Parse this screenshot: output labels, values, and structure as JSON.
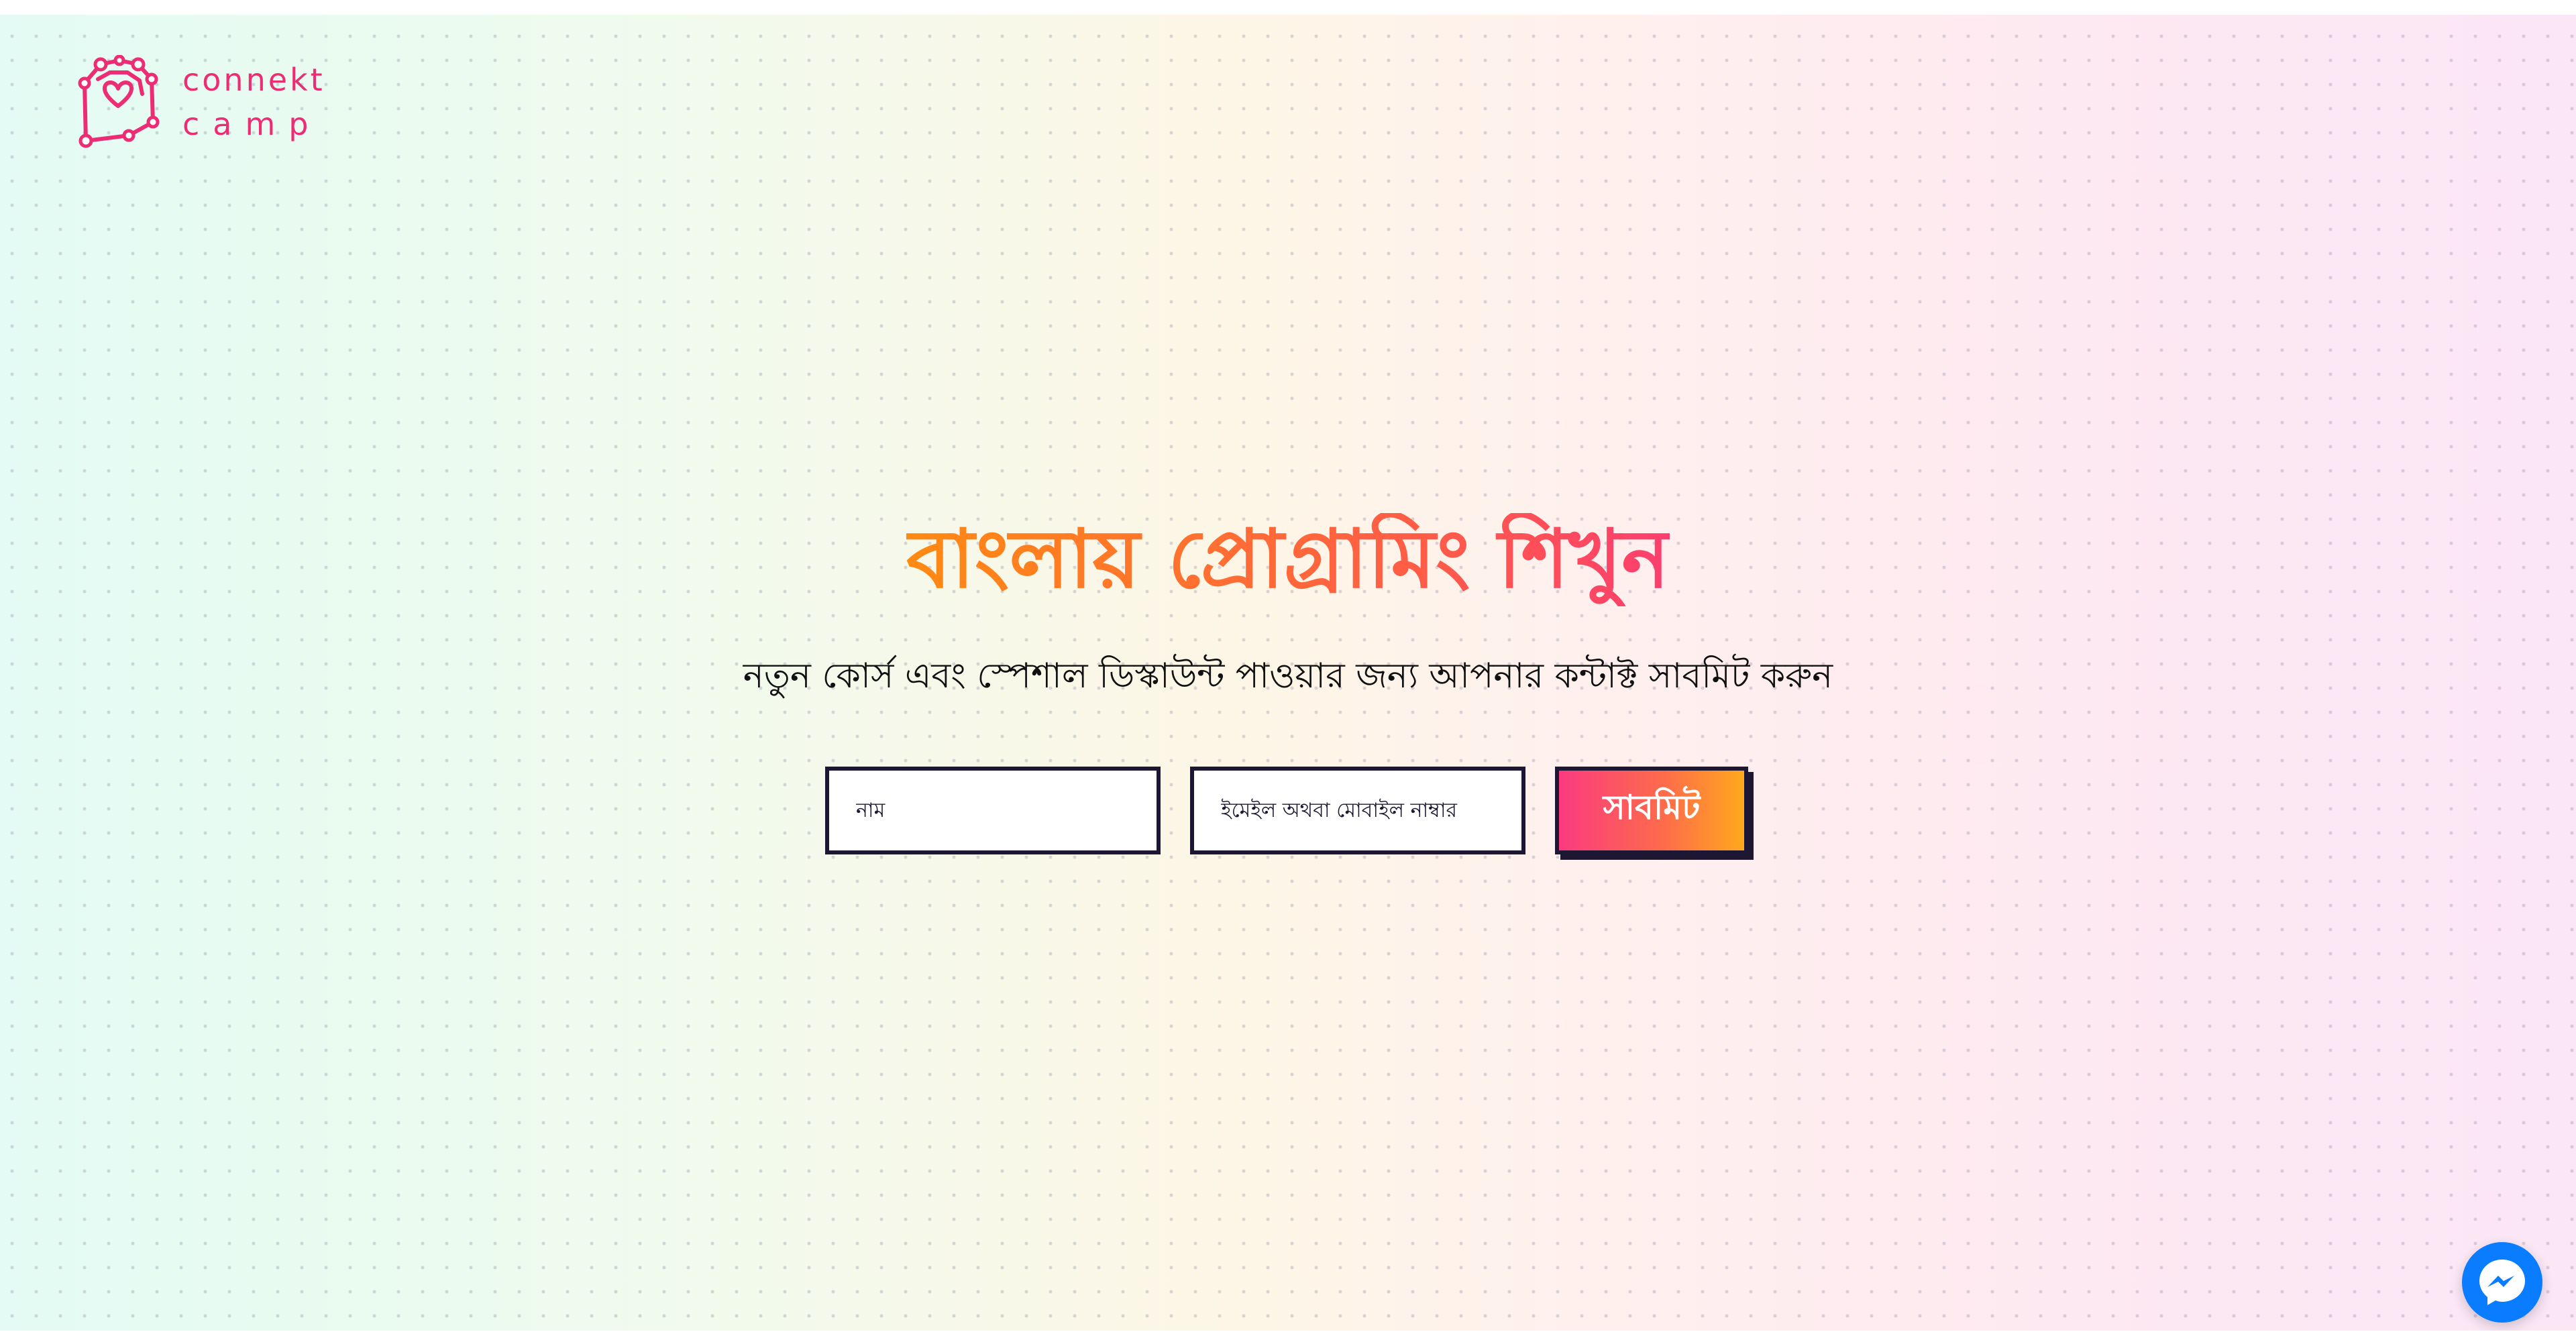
{
  "brand": {
    "line1": "connekt",
    "line2": "camp",
    "color": "#ec2d73"
  },
  "hero": {
    "title": "বাংলায় প্রোগ্রামিং শিখুন",
    "subtitle": "নতুন কোর্স এবং স্পেশাল ডিস্কাউন্ট পাওয়ার জন্য আপনার কন্টাক্ট সাবমিট করুন"
  },
  "form": {
    "name_placeholder": "নাম",
    "contact_placeholder": "ইমেইল অথবা মোবাইল নাম্বার",
    "submit_label": "সাবমিট"
  },
  "chat_widget": {
    "icon": "messenger-icon",
    "color": "#0a7cff"
  }
}
